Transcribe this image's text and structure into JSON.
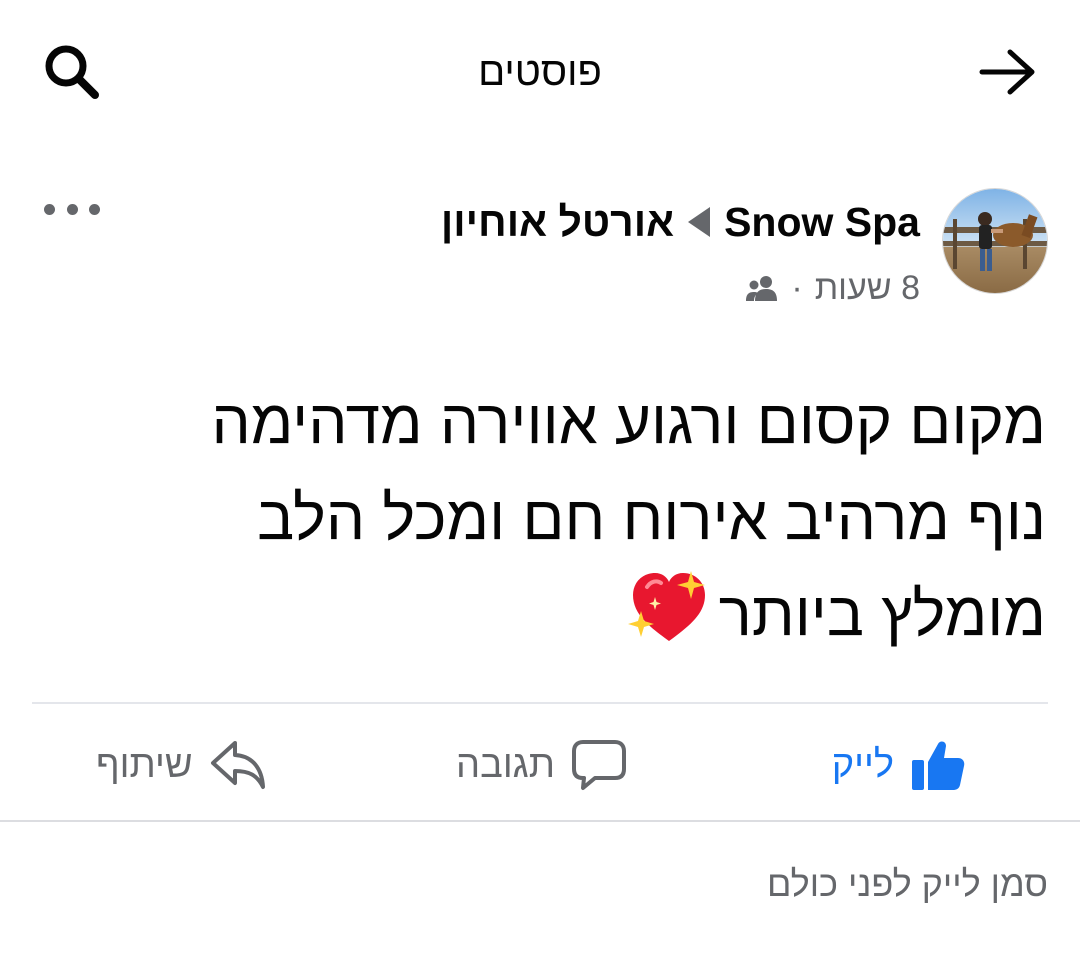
{
  "header": {
    "title": "פוסטים",
    "back_icon": "arrow-right-icon",
    "search_icon": "search-icon"
  },
  "post": {
    "page_name": "Snow Spa",
    "author": "אורטל אוחיון",
    "time": "8 שעות",
    "meta_separator": "·",
    "audience_icon": "friends-icon",
    "body_lines": [
      "מקום קסום ורגוע אווירה מדהימה",
      "נוף מרהיב אירוח חם ומכל הלב",
      "מומלץ ביותר"
    ],
    "body_emoji": "sparkling-heart-emoji",
    "more_icon": "more-horizontal-icon"
  },
  "actions": {
    "like_label": "לייק",
    "comment_label": "תגובה",
    "share_label": "שיתוף"
  },
  "footer": {
    "first_like_prompt": "סמן לייק לפני כולם"
  },
  "colors": {
    "like_blue": "#1877f2",
    "secondary_text": "#65676b",
    "divider": "#e4e6eb",
    "heart_red": "#e8172f",
    "sparkle_yellow": "#ffcf33"
  }
}
